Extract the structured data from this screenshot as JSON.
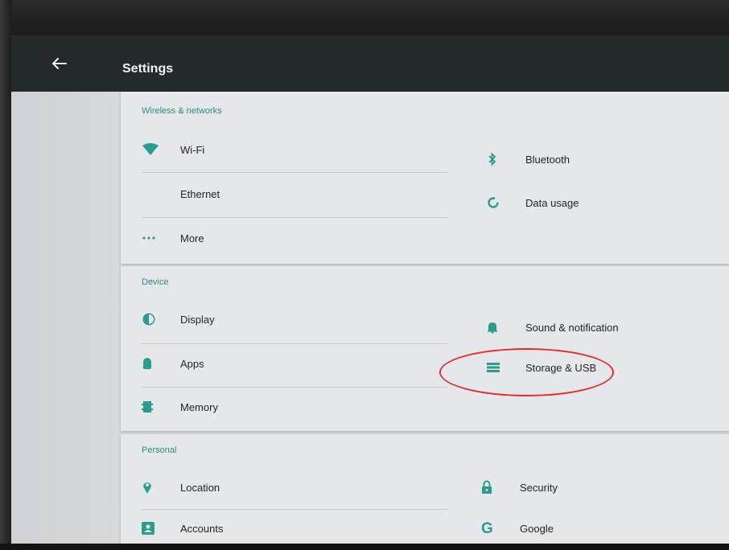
{
  "app": {
    "title": "Settings"
  },
  "sections": [
    {
      "header": "Wireless & networks",
      "left": [
        {
          "label": "Wi-Fi",
          "icon": "wifi-icon"
        },
        {
          "label": "Ethernet",
          "icon": ""
        },
        {
          "label": "More",
          "icon": "more-icon"
        }
      ],
      "right": [
        {
          "label": "Bluetooth",
          "icon": "bluetooth-icon"
        },
        {
          "label": "Data usage",
          "icon": "data-usage-icon"
        }
      ]
    },
    {
      "header": "Device",
      "left": [
        {
          "label": "Display",
          "icon": "display-icon"
        },
        {
          "label": "Apps",
          "icon": "apps-icon"
        },
        {
          "label": "Memory",
          "icon": "memory-icon"
        }
      ],
      "right": [
        {
          "label": "Sound & notification",
          "icon": "bell-icon"
        },
        {
          "label": "Storage & USB",
          "icon": "storage-icon"
        }
      ]
    },
    {
      "header": "Personal",
      "left": [
        {
          "label": "Location",
          "icon": "location-icon"
        },
        {
          "label": "Accounts",
          "icon": "accounts-icon"
        }
      ],
      "right": [
        {
          "label": "Security",
          "icon": "lock-icon"
        },
        {
          "label": "Google",
          "icon": "google-icon"
        }
      ]
    }
  ],
  "colors": {
    "accent": "#2a9d8f",
    "appbar": "#242a2c",
    "highlight": "#e0302e"
  }
}
